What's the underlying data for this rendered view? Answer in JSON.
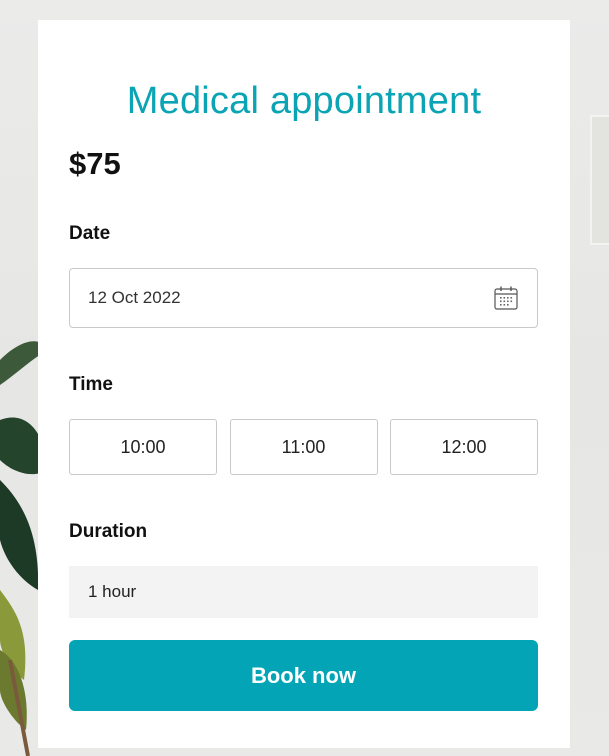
{
  "card": {
    "title": "Medical appointment",
    "price": "$75"
  },
  "date": {
    "label": "Date",
    "value": "12 Oct 2022",
    "icon": "calendar-icon"
  },
  "time": {
    "label": "Time",
    "slots": [
      "10:00",
      "11:00",
      "12:00"
    ]
  },
  "duration": {
    "label": "Duration",
    "value": "1 hour"
  },
  "actions": {
    "book_label": "Book now"
  },
  "colors": {
    "accent": "#02a4b6",
    "title": "#0aa4b5",
    "field_border": "#c9c9c9",
    "duration_bg": "#f3f3f3"
  }
}
